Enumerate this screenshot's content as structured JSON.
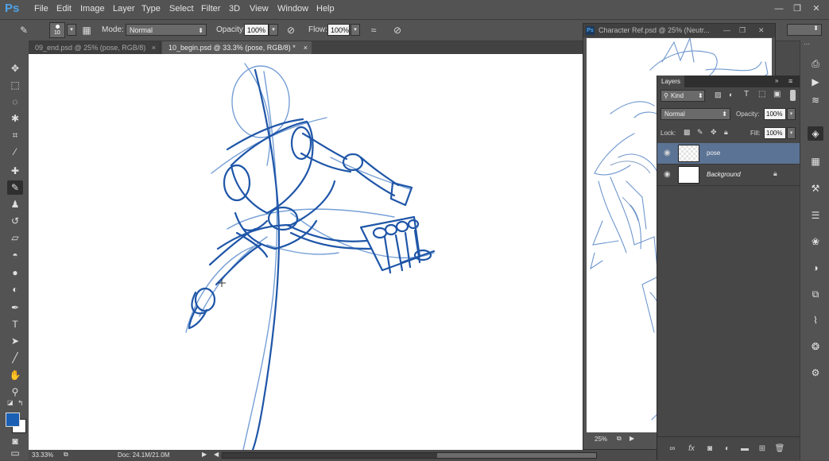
{
  "app": {
    "logo": "Ps"
  },
  "menu": [
    "File",
    "Edit",
    "Image",
    "Layer",
    "Type",
    "Select",
    "Filter",
    "3D",
    "View",
    "Window",
    "Help"
  ],
  "options": {
    "brush_size": "10",
    "mode_label": "Mode:",
    "mode_value": "Normal",
    "opacity_label": "Opacity:",
    "opacity_value": "100%",
    "flow_label": "Flow:",
    "flow_value": "100%"
  },
  "tabs": [
    {
      "label": "09_end.psd @ 25% (pose, RGB/8)",
      "close": "×",
      "active": false
    },
    {
      "label": "10_begin.psd @ 33.3% (pose, RGB/8) *",
      "close": "×",
      "active": true
    }
  ],
  "status": {
    "zoom": "33.33%",
    "doc": "Doc: 24.1M/21.0M"
  },
  "ref_window": {
    "title": "Character Ref.psd @ 25% (Neutr...",
    "zoom": "25%",
    "ps_badge": "Ps"
  },
  "layers_panel": {
    "tab_label": "Layers",
    "filter_kind": "Kind",
    "blend_mode": "Normal",
    "opacity_label": "Opacity:",
    "opacity_value": "100%",
    "lock_label": "Lock:",
    "fill_label": "Fill:",
    "fill_value": "100%",
    "layers": [
      {
        "name": "pose",
        "selected": true
      },
      {
        "name": "Background",
        "selected": false
      }
    ]
  },
  "colors": {
    "foreground": "#1b5fb5",
    "background": "#ffffff",
    "selection": "#5b7394",
    "sketch_stroke": "#1f56a8"
  },
  "icons": {
    "toolbar": [
      "move-icon",
      "marquee-icon",
      "lasso-icon",
      "magic-wand-icon",
      "crop-icon",
      "eyedropper-icon",
      "healing-brush-icon",
      "brush-icon",
      "clone-stamp-icon",
      "history-brush-icon",
      "eraser-icon",
      "paint-bucket-icon",
      "blur-icon",
      "dodge-icon",
      "pen-icon",
      "type-icon",
      "path-selection-icon",
      "line-icon",
      "hand-icon",
      "zoom-icon"
    ]
  }
}
